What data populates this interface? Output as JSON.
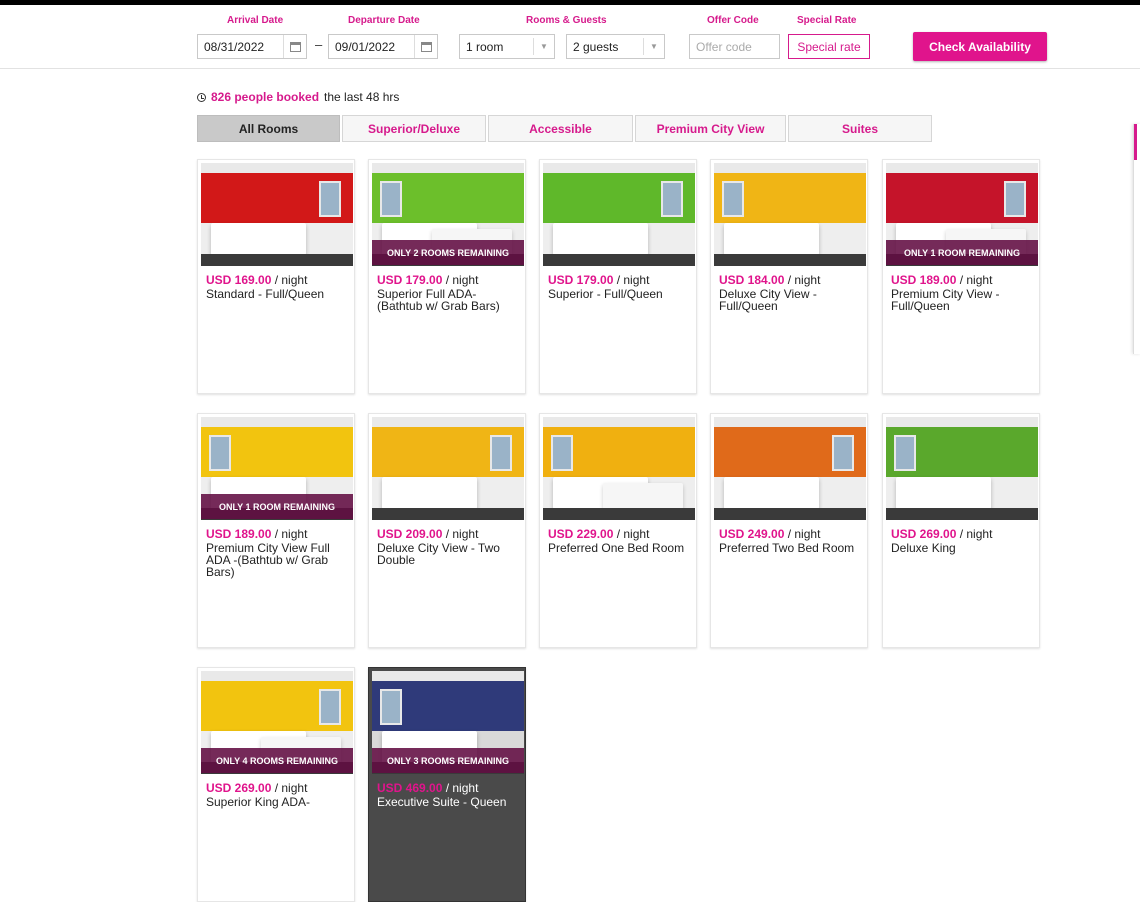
{
  "search": {
    "arrival_label": "Arrival Date",
    "arrival_value": "08/31/2022",
    "departure_label": "Departure Date",
    "departure_value": "09/01/2022",
    "rooms_guests_label": "Rooms & Guests",
    "rooms_value": "1 room",
    "guests_value": "2 guests",
    "offer_label": "Offer Code",
    "offer_placeholder": "Offer code",
    "special_label": "Special Rate",
    "special_button": "Special rate",
    "dash": "–",
    "check_button": "Check Availability"
  },
  "booked": {
    "count": "826 people booked",
    "suffix": "the last 48 hrs"
  },
  "tabs": [
    "All Rooms",
    "Superior/Deluxe",
    "Accessible",
    "Premium City View",
    "Suites"
  ],
  "per_night": "/ night",
  "rooms": [
    {
      "price": "USD 169.00",
      "name": "Standard - Full/Queen",
      "remaining": "",
      "wall": "#d21818"
    },
    {
      "price": "USD 179.00",
      "name": "Superior Full ADA-(Bathtub w/ Grab Bars)",
      "remaining": "ONLY 2 ROOMS REMAINING",
      "wall": "#6cbf2b"
    },
    {
      "price": "USD 179.00",
      "name": "Superior - Full/Queen",
      "remaining": "",
      "wall": "#5fb82a"
    },
    {
      "price": "USD 184.00",
      "name": "Deluxe City View - Full/Queen",
      "remaining": "",
      "wall": "#f0b515"
    },
    {
      "price": "USD 189.00",
      "name": "Premium City View - Full/Queen",
      "remaining": "ONLY 1 ROOM REMAINING",
      "wall": "#c5142a"
    },
    {
      "price": "USD 189.00",
      "name": "Premium City View Full ADA -(Bathtub w/ Grab Bars)",
      "remaining": "ONLY 1 ROOM REMAINING",
      "wall": "#f2c40f"
    },
    {
      "price": "USD 209.00",
      "name": "Deluxe City View - Two Double",
      "remaining": "",
      "wall": "#f0b515"
    },
    {
      "price": "USD 229.00",
      "name": "Preferred One Bed Room",
      "remaining": "",
      "wall": "#f0b010"
    },
    {
      "price": "USD 249.00",
      "name": "Preferred Two Bed Room",
      "remaining": "",
      "wall": "#e06a1a"
    },
    {
      "price": "USD 269.00",
      "name": "Deluxe King",
      "remaining": "",
      "wall": "#5aa82c"
    },
    {
      "price": "USD 269.00",
      "name": "Superior King ADA-",
      "remaining": "ONLY 4 ROOMS REMAINING",
      "wall": "#f2c40f"
    },
    {
      "price": "USD 469.00",
      "name": "Executive Suite - Queen",
      "remaining": "ONLY 3 ROOMS REMAINING",
      "wall": "#2f3a7a"
    }
  ],
  "colors": {
    "accent": "#e0148c",
    "remaining_bg": "#620c42"
  }
}
